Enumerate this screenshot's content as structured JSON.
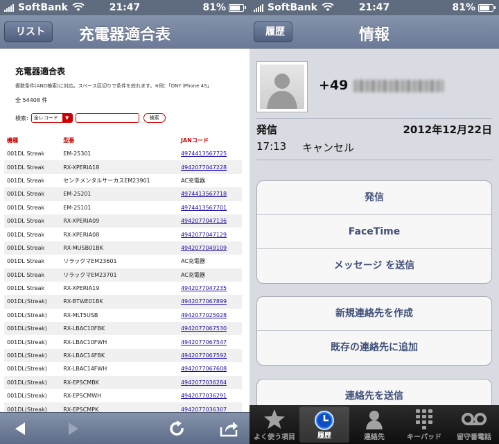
{
  "status_bar": {
    "carrier": "SoftBank",
    "time": "21:47",
    "battery": "81%"
  },
  "left": {
    "nav": {
      "back_label": "リスト",
      "title": "充電器適合表"
    },
    "page": {
      "heading": "充電器適合表",
      "note": "複数条件(AND検索)に対応。スペース区切りで条件を絞れます。※例：「DNY iPhone 4S」",
      "count": "全 54408 件",
      "search_label": "検索:",
      "select_value": "全レコード",
      "search_button": "検索"
    },
    "table": {
      "headers": [
        "機種",
        "型番",
        "JANコード"
      ],
      "rows": [
        [
          "001DL Streak",
          "EM-25301",
          "4974413567725"
        ],
        [
          "001DL Streak",
          "RX-XPERIA18",
          "4942077047228"
        ],
        [
          "001DL Streak",
          "センチメンタルサーカスEM23901",
          "AC充電器"
        ],
        [
          "001DL Streak",
          "EM-25201",
          "4974413567718"
        ],
        [
          "001DL Streak",
          "EM-25101",
          "4974413567701"
        ],
        [
          "001DL Streak",
          "RX-XPERIA09",
          "4942077047136"
        ],
        [
          "001DL Streak",
          "RX-XPERIA08",
          "4942077047129"
        ],
        [
          "001DL Streak",
          "RX-MUSB01BK",
          "4942077049109"
        ],
        [
          "001DL Streak",
          "リラックマEM23601",
          "AC充電器"
        ],
        [
          "001DL Streak",
          "リラックマEM23701",
          "AC充電器"
        ],
        [
          "001DL Streak",
          "RX-XPERIA19",
          "4942077047235"
        ],
        [
          "001DL(Streak)",
          "RX-BTWE01BK",
          "4942077067899"
        ],
        [
          "001DL(Streak)",
          "RX-MLT5USB",
          "4942077025028"
        ],
        [
          "001DL(Streak)",
          "RX-LBAC10FBK",
          "4942077067530"
        ],
        [
          "001DL(Streak)",
          "RX-LBAC10FWH",
          "4942077067547"
        ],
        [
          "001DL(Streak)",
          "RX-LBAC14FBK",
          "4942077067592"
        ],
        [
          "001DL(Streak)",
          "RX-LBAC14FWH",
          "4942077067608"
        ],
        [
          "001DL(Streak)",
          "RX-EPSCMBK",
          "4942077036284"
        ],
        [
          "001DL(Streak)",
          "RX-EPSCMWH",
          "4942077036291"
        ],
        [
          "001DL(Streak)",
          "RX-EPSCMPK",
          "4942077036307"
        ]
      ]
    }
  },
  "right": {
    "nav": {
      "back_label": "履歴",
      "title": "情報"
    },
    "contact": {
      "number_prefix": "+49"
    },
    "call": {
      "type": "発信",
      "date": "2012年12月22日",
      "time": "17:13",
      "status": "キャンセル"
    },
    "actions_group1": [
      "発信",
      "FaceTime",
      "メッセージ を送信"
    ],
    "actions_group2": [
      "新規連絡先を作成",
      "既存の連絡先に追加"
    ],
    "actions_group3": [
      "連絡先を送信"
    ],
    "tabs": [
      {
        "label": "よく使う項目",
        "icon": "star-icon"
      },
      {
        "label": "履歴",
        "icon": "clock-icon",
        "active": true
      },
      {
        "label": "連絡先",
        "icon": "contacts-icon"
      },
      {
        "label": "キーパッド",
        "icon": "keypad-icon"
      },
      {
        "label": "留守番電話",
        "icon": "voicemail-icon"
      }
    ]
  }
}
